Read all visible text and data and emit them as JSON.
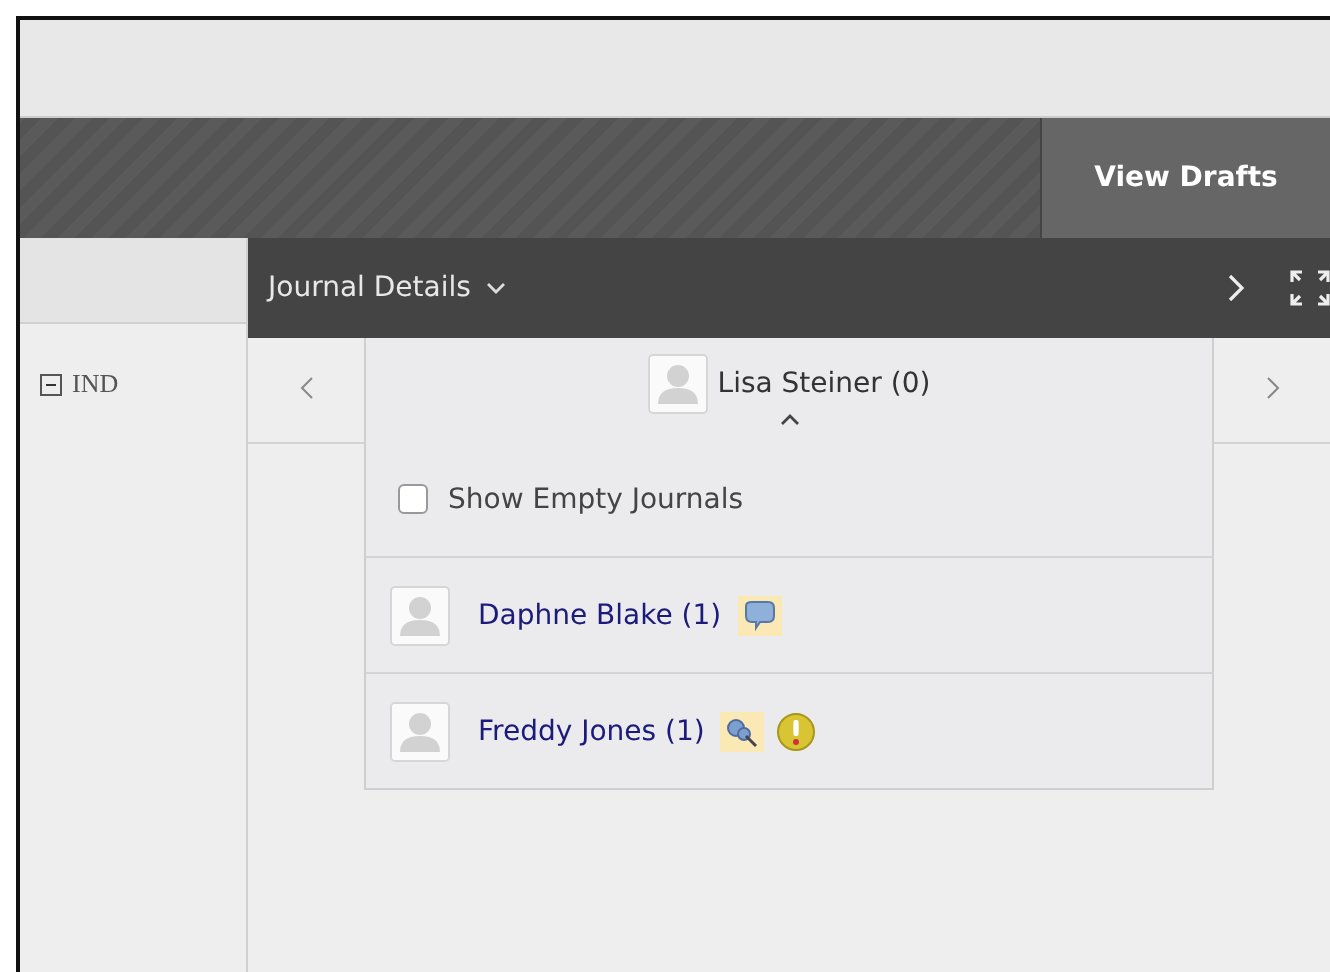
{
  "toolbar": {
    "button": "View Drafts"
  },
  "panel": {
    "title": "Journal Details",
    "tree_label": "IND",
    "expanded": true
  },
  "navigator": {
    "current": "Lisa Steiner (0)"
  },
  "dropdown": {
    "show_empty": {
      "label": "Show Empty Journals",
      "checked": false
    },
    "users": [
      {
        "name": "Daphne Blake (1)",
        "badges": [
          {
            "kind": "comment"
          }
        ]
      },
      {
        "name": "Freddy Jones (1)",
        "badges": [
          {
            "kind": "pin"
          },
          {
            "kind": "alert"
          }
        ]
      }
    ]
  }
}
